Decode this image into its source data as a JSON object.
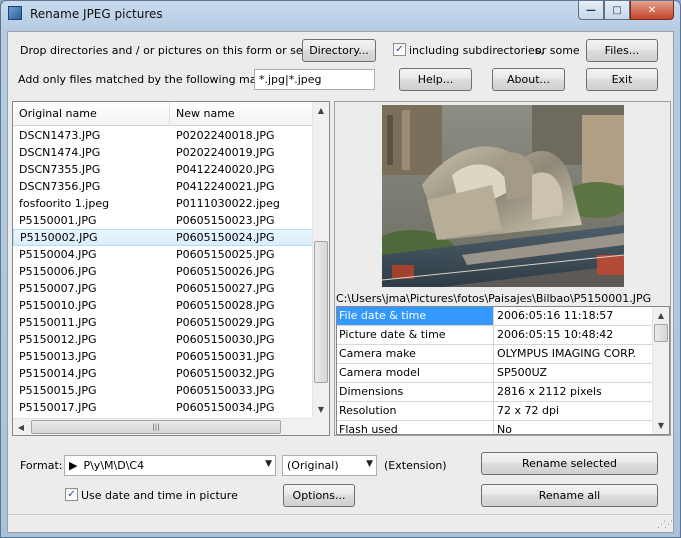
{
  "window": {
    "title": "Rename JPEG pictures"
  },
  "caption_buttons": {
    "minimize": "—",
    "maximize": "□",
    "close": "✕"
  },
  "top": {
    "drop_text": "Drop directories and / or pictures on this form or select a",
    "directory_btn": "Directory...",
    "subdirs_label": "including subdirectories,",
    "subdirs_checked": true,
    "or_some": "or some",
    "files_btn": "Files...",
    "mask_label": "Add only files matched by the following mask(s) :",
    "mask_value": "*.jpg|*.jpeg",
    "help_btn": "Help...",
    "about_btn": "About...",
    "exit_btn": "Exit"
  },
  "filelist": {
    "col_original": "Original name",
    "col_new": "New name",
    "selected_index": 6,
    "rows": [
      {
        "orig": "DSCN1473.JPG",
        "new": "P0202240018.JPG"
      },
      {
        "orig": "DSCN1474.JPG",
        "new": "P0202240019.JPG"
      },
      {
        "orig": "DSCN7355.JPG",
        "new": "P0412240020.JPG"
      },
      {
        "orig": "DSCN7356.JPG",
        "new": "P0412240021.JPG"
      },
      {
        "orig": "fosfoorito 1.jpeg",
        "new": "P0111030022.jpeg"
      },
      {
        "orig": "P5150001.JPG",
        "new": "P0605150023.JPG"
      },
      {
        "orig": "P5150002.JPG",
        "new": "P0605150024.JPG"
      },
      {
        "orig": "P5150004.JPG",
        "new": "P0605150025.JPG"
      },
      {
        "orig": "P5150006.JPG",
        "new": "P0605150026.JPG"
      },
      {
        "orig": "P5150007.JPG",
        "new": "P0605150027.JPG"
      },
      {
        "orig": "P5150010.JPG",
        "new": "P0605150028.JPG"
      },
      {
        "orig": "P5150011.JPG",
        "new": "P0605150029.JPG"
      },
      {
        "orig": "P5150012.JPG",
        "new": "P0605150030.JPG"
      },
      {
        "orig": "P5150013.JPG",
        "new": "P0605150031.JPG"
      },
      {
        "orig": "P5150014.JPG",
        "new": "P0605150032.JPG"
      },
      {
        "orig": "P5150015.JPG",
        "new": "P0605150033.JPG"
      },
      {
        "orig": "P5150017.JPG",
        "new": "P0605150034.JPG"
      }
    ]
  },
  "preview": {
    "path": "C:\\Users\\jma\\Pictures\\fotos\\Paisajes\\Bilbao\\P5150001.JPG",
    "props": [
      {
        "k": "File date & time",
        "v": "2006:05:16 11:18:57"
      },
      {
        "k": "Picture date & time",
        "v": "2006:05:15 10:48:42"
      },
      {
        "k": "Camera make",
        "v": "OLYMPUS IMAGING CORP."
      },
      {
        "k": "Camera model",
        "v": "SP500UZ"
      },
      {
        "k": "Dimensions",
        "v": "2816 x 2112 pixels"
      },
      {
        "k": "Resolution",
        "v": "72 x 72 dpi"
      },
      {
        "k": "Flash used",
        "v": "No"
      }
    ]
  },
  "bottom": {
    "format_label": "Format:",
    "format_value": "P\\y\\M\\D\\C4",
    "case_value": "(Original)",
    "extension_label": "(Extension)",
    "rename_selected_btn": "Rename selected",
    "use_date_label": "Use date and time in picture",
    "use_date_checked": true,
    "options_btn": "Options...",
    "rename_all_btn": "Rename all"
  }
}
